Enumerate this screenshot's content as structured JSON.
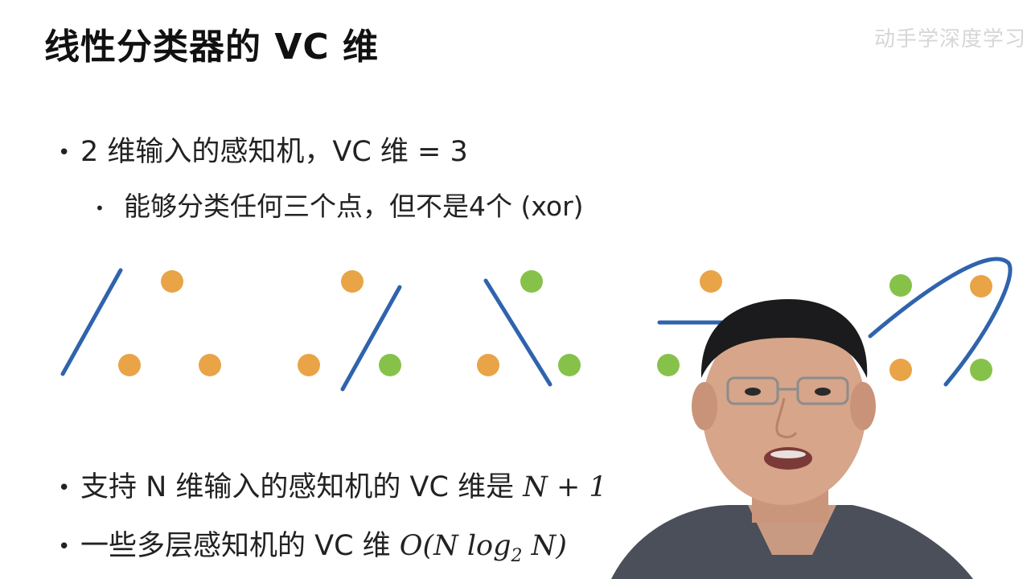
{
  "slide": {
    "title": "线性分类器的 VC 维",
    "watermark": "动手学深度学习",
    "bullets": {
      "b1": "2 维输入的感知机，VC 维 = 3",
      "b1_sub": "能够分类任何三个点，但不是4个 (xor)",
      "b2_prefix": "支持 N 维输入的感知机的 VC 维是 ",
      "b2_math": "N + 1",
      "b3_prefix": "一些多层感知机的 VC 维 ",
      "b3_math_a": "O(N log",
      "b3_math_sub": "2",
      "b3_math_b": " N)"
    }
  },
  "colors": {
    "orange": "#e9a447",
    "green": "#86c24a",
    "line": "#2f63ad"
  }
}
